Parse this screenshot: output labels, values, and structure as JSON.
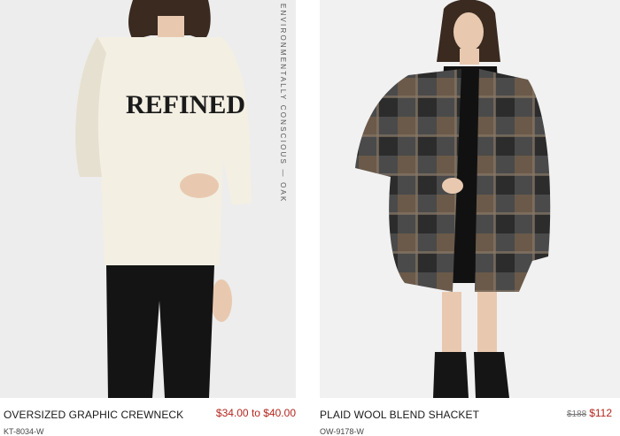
{
  "products": [
    {
      "name": "OVERSIZED GRAPHIC CREWNECK",
      "price": "$34.00 to $40.00",
      "sku": "KT-8034-W",
      "print_text": "REFINED",
      "side_text": "ENVIRONMENTALLY CONSCIOUS — OAK"
    },
    {
      "name": "PLAID WOOL BLEND SHACKET",
      "old_price": "$188",
      "sale_price": "$112",
      "sku": "OW-9178-W"
    }
  ],
  "colors": {
    "sale_red": "#b3261e",
    "sweater": "#f3efe3",
    "plaid_brown": "#6b5a4a",
    "plaid_grey": "#4a4a4a"
  }
}
